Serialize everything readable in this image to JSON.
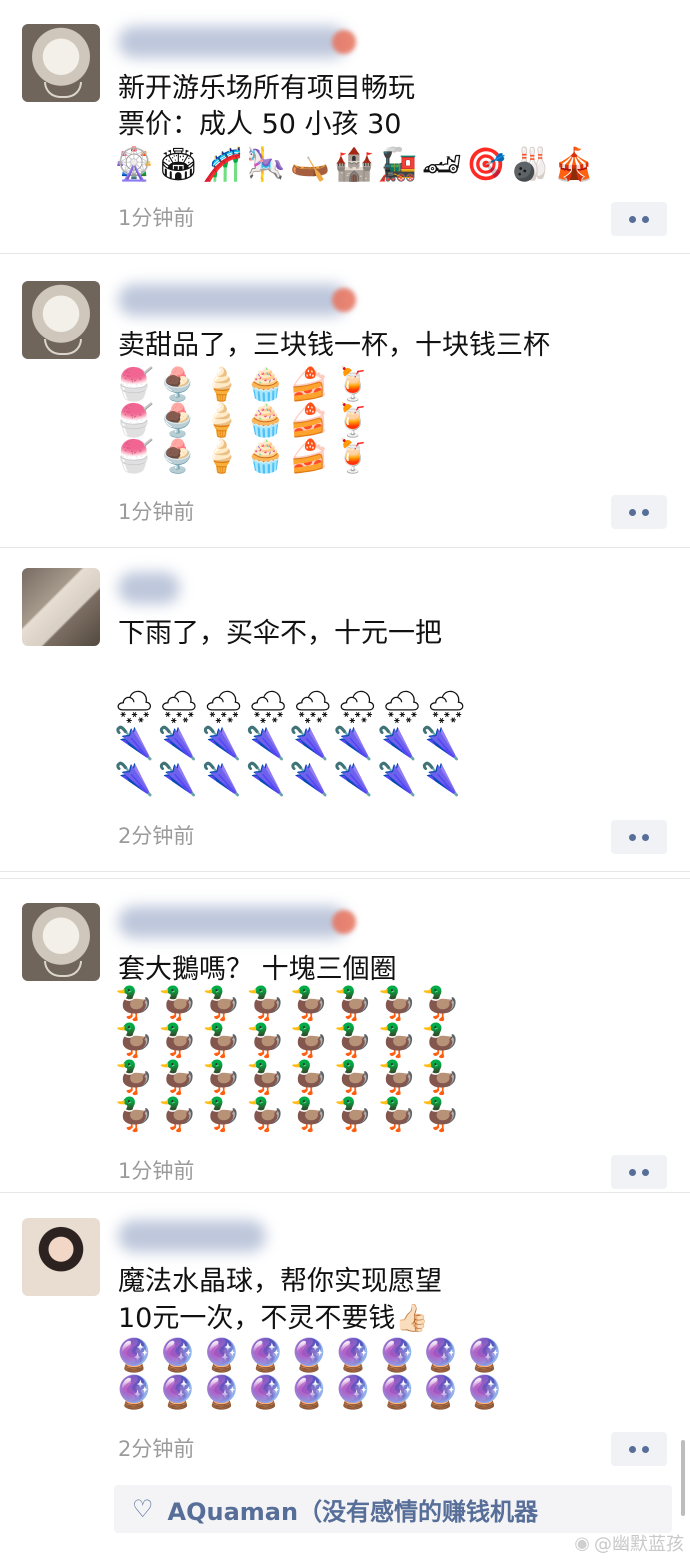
{
  "posts": [
    {
      "avatar": "dog-photo",
      "lines": [
        "新开游乐场所有项目畅玩",
        "票价：成人 50 小孩 30"
      ],
      "emoji_rows": [
        "🎡🏟🎢🎠🛶🏰🚂🏎🎯🎳🎪"
      ],
      "time": "1分钟前"
    },
    {
      "avatar": "dog-photo",
      "lines": [
        "卖甜品了，三块钱一杯，十块钱三杯"
      ],
      "emoji_rows": [
        "🍧🍨🍦🧁🍰🍹",
        "🍧🍨🍦🧁🍰🍹",
        "🍧🍨🍦🧁🍰🍹"
      ],
      "time": "1分钟前"
    },
    {
      "avatar": "paper-photo",
      "lines": [
        "下雨了，买伞不，十元一把"
      ],
      "emoji_rows": [
        "🌨🌨🌨🌨🌨🌨🌨🌨",
        "🌂🌂🌂🌂🌂🌂🌂🌂",
        "🌂🌂🌂🌂🌂🌂🌂🌂"
      ],
      "time": "2分钟前"
    },
    {
      "avatar": "dog-photo",
      "lines": [
        "套大鵝嗎？ 十塊三個圈"
      ],
      "emoji_rows": [
        "🦆🦆🦆🦆🦆🦆🦆🦆",
        "🦆🦆🦆🦆🦆🦆🦆🦆",
        "🦆🦆🦆🦆🦆🦆🦆🦆",
        "🦆🦆🦆🦆🦆🦆🦆🦆"
      ],
      "time": "1分钟前"
    },
    {
      "avatar": "girl-photo",
      "lines": [
        "魔法水晶球，帮你实现愿望",
        "10元一次，不灵不要钱👍🏻"
      ],
      "emoji_rows": [
        "🔮🔮🔮🔮🔮🔮🔮🔮🔮",
        "🔮🔮🔮🔮🔮🔮🔮🔮🔮"
      ],
      "time": "2分钟前"
    }
  ],
  "likes": {
    "text": "AQuaman（没有感情的赚钱机器"
  },
  "watermark": {
    "text": "@幽默蓝孩"
  },
  "icons": {
    "like": "heart-icon",
    "more": "more-dots-icon",
    "weibo": "weibo-icon"
  },
  "colors": {
    "link_blue": "#566e98",
    "time_gray": "#9b9b9b",
    "button_bg": "#f1f2f6"
  }
}
